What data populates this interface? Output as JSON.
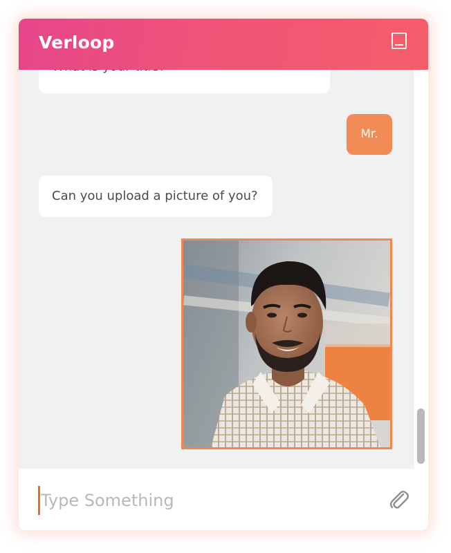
{
  "header": {
    "title": "Verloop",
    "minimize_icon": "minimize-icon",
    "gradient_start": "#e6468a",
    "gradient_end": "#f55d6a"
  },
  "messages": [
    {
      "sender": "bot",
      "text": "What is your title?"
    },
    {
      "sender": "user",
      "text": "Mr."
    },
    {
      "sender": "bot",
      "text": "Can you upload a picture of you?"
    },
    {
      "sender": "user",
      "type": "image",
      "description": "uploaded photo"
    }
  ],
  "composer": {
    "placeholder": "Type Something",
    "value": "",
    "attach_icon": "paperclip-icon"
  },
  "colors": {
    "accent": "#f28b56",
    "photo_border": "#f0874d",
    "cursor": "#e96a2d",
    "chat_background": "#f1f1f1"
  }
}
